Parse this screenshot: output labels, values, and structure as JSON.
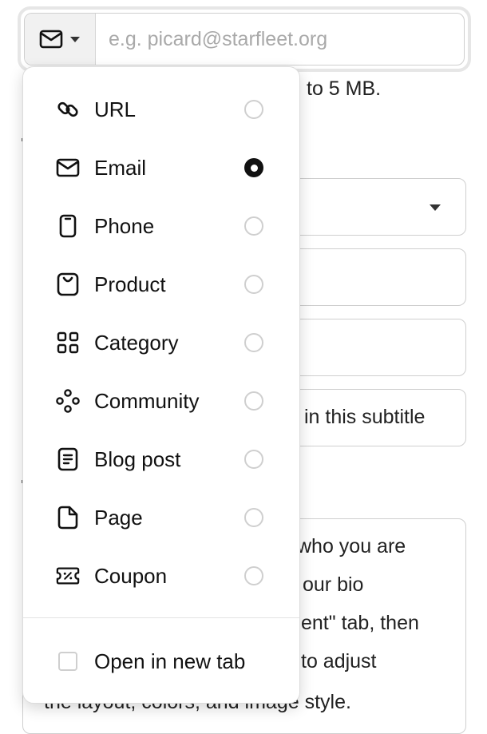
{
  "link_field": {
    "type_icon": "mail-icon",
    "caret_icon": "caret-down-icon",
    "placeholder": "e.g. picard@starfleet.org"
  },
  "background": {
    "size_hint_fragment": "to 5 MB.",
    "subtitle_fragment": "in this subtitle",
    "bio_lines": [
      "who you are",
      "our bio",
      "ent\" tab, then",
      "to adjust",
      "the layout, colors, and image style."
    ]
  },
  "menu": {
    "items": [
      {
        "icon": "link-icon",
        "label": "URL",
        "selected": false
      },
      {
        "icon": "mail-icon",
        "label": "Email",
        "selected": true
      },
      {
        "icon": "phone-icon",
        "label": "Phone",
        "selected": false
      },
      {
        "icon": "shopping-bag-icon",
        "label": "Product",
        "selected": false
      },
      {
        "icon": "grid-icon",
        "label": "Category",
        "selected": false
      },
      {
        "icon": "community-icon",
        "label": "Community",
        "selected": false
      },
      {
        "icon": "document-icon",
        "label": "Blog post",
        "selected": false
      },
      {
        "icon": "page-icon",
        "label": "Page",
        "selected": false
      },
      {
        "icon": "coupon-icon",
        "label": "Coupon",
        "selected": false
      }
    ],
    "open_new_tab": {
      "label": "Open in new tab",
      "checked": false
    }
  },
  "colors": {
    "selected_radio": "#111111",
    "border": "#cfcfcf",
    "accent_bg": "#f1f1f1"
  }
}
